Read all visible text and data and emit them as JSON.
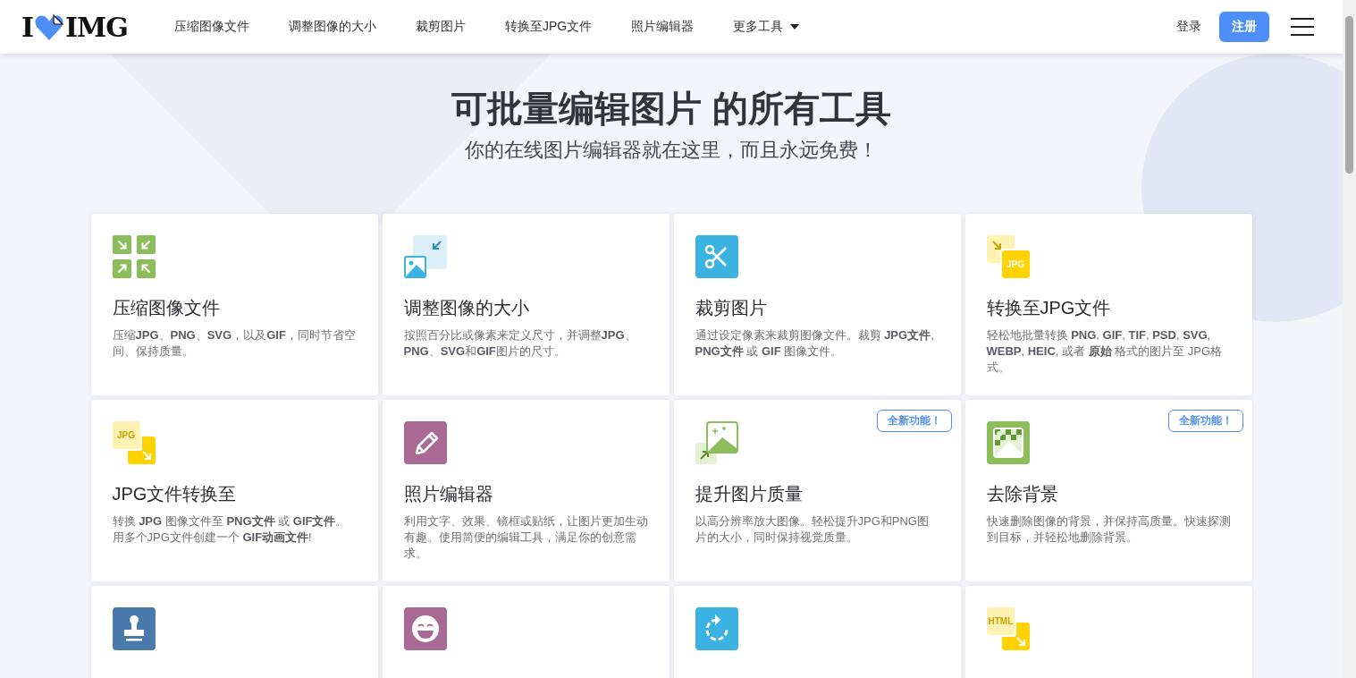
{
  "logo": {
    "left": "I",
    "right": "IMG"
  },
  "nav": [
    {
      "label": "压缩图像文件"
    },
    {
      "label": "调整图像的大小"
    },
    {
      "label": "裁剪图片"
    },
    {
      "label": "转换至JPG文件"
    },
    {
      "label": "照片编辑器"
    },
    {
      "label": "更多工具",
      "dropdown": true
    }
  ],
  "login": "登录",
  "signup": "注册",
  "hero": {
    "title": "可批量编辑图片 的所有工具",
    "subtitle": "你的在线图片编辑器就在这里，而且永远免费！"
  },
  "tools": [
    {
      "kind": "compress",
      "title": "压缩图像文件",
      "description": "压缩**JPG**、**PNG**、**SVG**，以及**GIF**，同时节省空间、保持质量。"
    },
    {
      "kind": "resize",
      "title": "调整图像的大小",
      "description": "按照百分比或像素来定义尺寸，并调整**JPG**、**PNG**、**SVG**和**GIF**图片的尺寸。"
    },
    {
      "kind": "crop",
      "title": "裁剪图片",
      "description": "通过设定像素来裁剪图像文件。裁剪 **JPG文件**, **PNG文件** 或 **GIF** 图像文件。"
    },
    {
      "kind": "to-format",
      "icon_label": "JPG",
      "title": "转换至JPG文件",
      "description": "轻松地批量转换 **PNG**, **GIF**, **TIF**, **PSD**, **SVG**, **WEBP**, **HEIC**, 或者 **原始** 格式的图片至 JPG格式。"
    },
    {
      "kind": "from-format",
      "icon_label": "JPG",
      "title": "JPG文件转换至",
      "description": "转换 **JPG** 图像文件至 **PNG文件** 或 **GIF文件**。用多个JPG文件创建一个 **GIF动画文件**!"
    },
    {
      "kind": "editor",
      "title": "照片编辑器",
      "description": "利用文字、效果、镜框或贴纸，让图片更加生动有趣。使用简便的编辑工具，满足你的创意需求。"
    },
    {
      "kind": "upscale",
      "title": "提升图片质量",
      "description": "以高分辨率放大图像。轻松提升JPG和PNG图片的大小，同时保持视觉质量。",
      "badge": "全新功能！"
    },
    {
      "kind": "remove-bg",
      "title": "去除背景",
      "description": "快速删除图像的背景，并保持高质量。快速探测到目标，并轻松地删除背景。",
      "badge": "全新功能！"
    },
    {
      "kind": "watermark"
    },
    {
      "kind": "meme"
    },
    {
      "kind": "rotate"
    },
    {
      "kind": "from-format",
      "icon_label": "HTML"
    }
  ]
}
